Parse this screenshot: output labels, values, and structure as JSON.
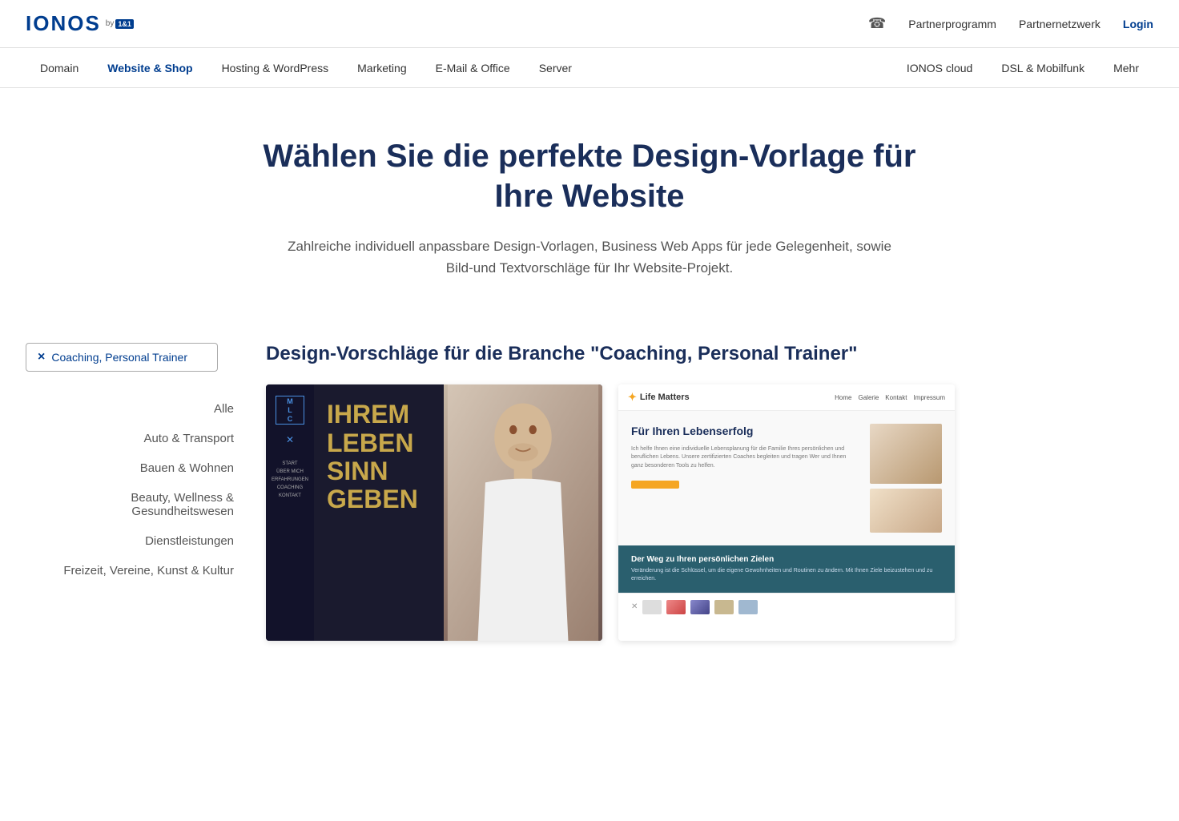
{
  "brand": {
    "name": "IONOS",
    "by_label": "by",
    "badge": "1&1"
  },
  "top_nav": {
    "phone_label": "phone",
    "links": [
      {
        "label": "Partnerprogramm",
        "id": "partnerprogramm"
      },
      {
        "label": "Partnernetzwerk",
        "id": "partnernetzwerk"
      }
    ],
    "login_label": "Login"
  },
  "main_nav": {
    "items": [
      {
        "label": "Domain",
        "id": "domain",
        "active": false
      },
      {
        "label": "Website & Shop",
        "id": "website-shop",
        "active": true
      },
      {
        "label": "Hosting & WordPress",
        "id": "hosting",
        "active": false
      },
      {
        "label": "Marketing",
        "id": "marketing",
        "active": false
      },
      {
        "label": "E-Mail & Office",
        "id": "email",
        "active": false
      },
      {
        "label": "Server",
        "id": "server",
        "active": false
      }
    ],
    "right_items": [
      {
        "label": "IONOS cloud",
        "id": "cloud"
      },
      {
        "label": "DSL & Mobilfunk",
        "id": "dsl"
      },
      {
        "label": "Mehr",
        "id": "mehr"
      }
    ]
  },
  "hero": {
    "title": "Wählen Sie die perfekte Design-Vorlage für Ihre Website",
    "subtitle": "Zahlreiche individuell anpassbare Design-Vorlagen, Business Web Apps für jede Gelegenheit, sowie Bild-und Textvorschläge für Ihr Website-Projekt."
  },
  "sidebar": {
    "filter_tag": {
      "label": "Coaching, Personal Trainer",
      "x_symbol": "×"
    },
    "categories": [
      {
        "label": "Alle",
        "id": "alle"
      },
      {
        "label": "Auto & Transport",
        "id": "auto-transport"
      },
      {
        "label": "Bauen & Wohnen",
        "id": "bauen-wohnen"
      },
      {
        "label": "Beauty, Wellness & Gesundheitswesen",
        "id": "beauty"
      },
      {
        "label": "Dienstleistungen",
        "id": "dienstleistungen"
      },
      {
        "label": "Freizeit, Vereine, Kunst & Kultur",
        "id": "freizeit"
      }
    ]
  },
  "main_content": {
    "section_title": "Design-Vorschläge für die Branche \"Coaching, Personal Trainer\"",
    "templates": [
      {
        "id": "template-1",
        "style": "dark",
        "logo_letters": "M\nL\nC",
        "big_text_lines": [
          "IHREM",
          "LEBEN",
          "SINN",
          "GEBEN"
        ],
        "sidebar_links": [
          "START",
          "ÜBER MICH",
          "ERFAHRUNGEN",
          "COACHING",
          "KONTAKT"
        ]
      },
      {
        "id": "template-2",
        "style": "light",
        "logo_name": "Life Matters",
        "nav_links": [
          "Home",
          "Galerie",
          "Kontakt",
          "Impressum"
        ],
        "hero_title": "Für Ihren Lebenserfolg",
        "hero_body": "Ich helfe Ihnen eine individuelle Lebensplanung für die Familie Ihres persönlichen und beruflichen Lebens. Unsere zertifizierten Coaches begleiten und tragen Wer und Ihnen ganz besonderen Tools zu helfen.",
        "cta_label": "",
        "teal_title": "Der Weg zu Ihren persönlichen Zielen",
        "teal_body": "Veränderung ist die Schlüssel, um die eigene Gewohnheiten und Routinen zu ändern. Mit Ihnen Ziele beizustehen und zu erreichen."
      }
    ]
  }
}
